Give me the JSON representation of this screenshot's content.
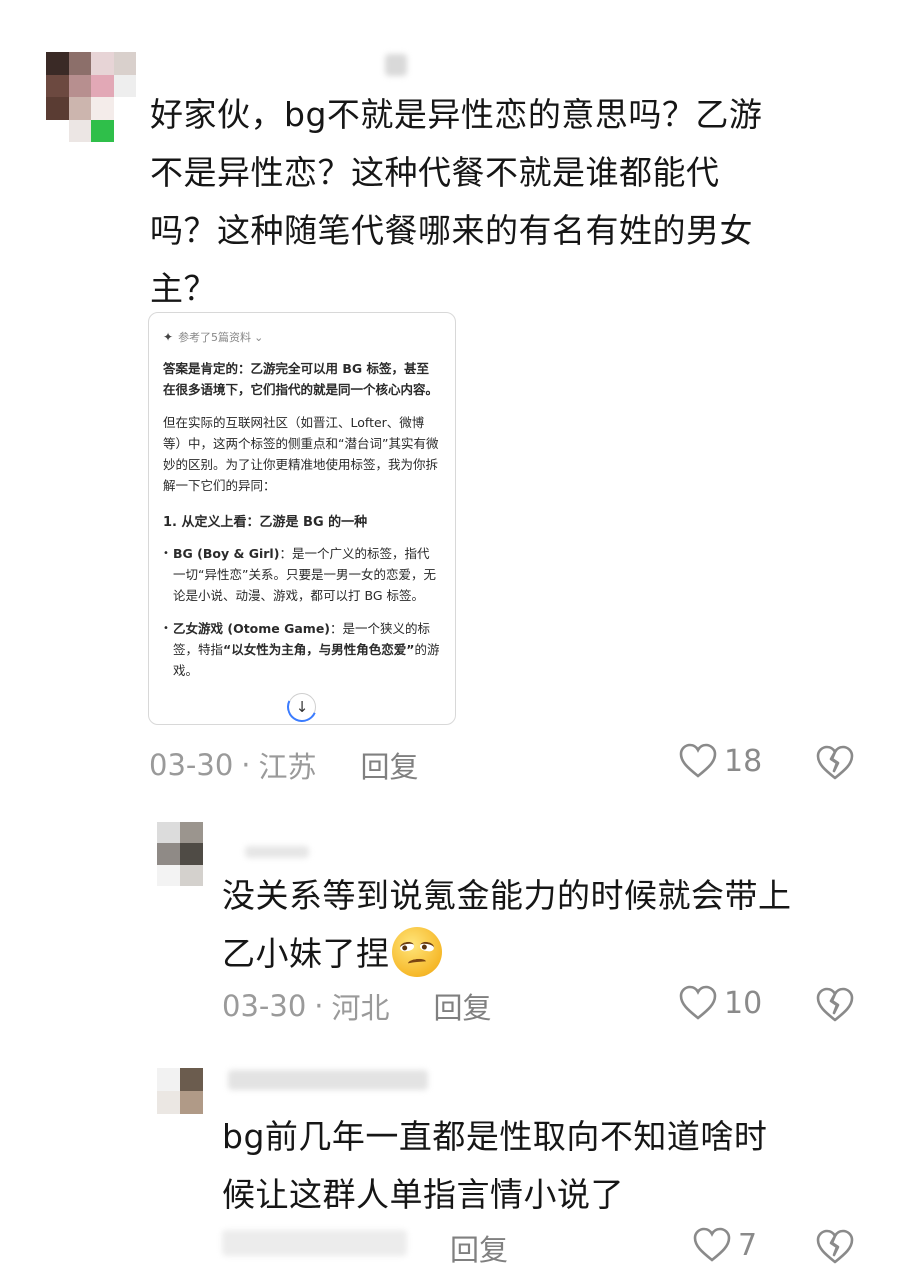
{
  "comments": [
    {
      "text_lines": [
        "好家伙，bg不就是异性恋的意思吗？乙游",
        "不是异性恋？这种代餐不就是谁都能代",
        "吗？这种随笔代餐哪来的有名有姓的男女",
        "主？"
      ],
      "date": "03-30",
      "location": "江苏",
      "reply_label": "回复",
      "likes": "18",
      "attachment": {
        "ref_label": "参考了5篇资料",
        "intro": "答案是肯定的：乙游完全可以用 BG 标签，甚至在很多语境下，它们指代的就是同一个核心内容。",
        "para": "但在实际的互联网社区（如晋江、Lofter、微博等）中，这两个标签的侧重点和“潜台词”其实有微妙的区别。为了让你更精准地使用标签，我为你拆解一下它们的异同：",
        "heading": "1. 从定义上看：乙游是 BG 的一种",
        "bullet1_bold": "BG (Boy & Girl)",
        "bullet1_text": "：是一个广义的标签，指代一切“异性恋”关系。只要是一男一女的恋爱，无论是小说、动漫、游戏，都可以打 BG 标签。",
        "bullet2_bold": "乙女游戏 (Otome Game)",
        "bullet2_text": "：是一个狭义的标签，特指",
        "bullet2_bold2": "“以女性为主角，与男性角色恋爱”",
        "bullet2_tail": "的游戏。"
      }
    },
    {
      "text_lines": [
        "没关系等到说氪金能力的时候就会带上",
        "乙小妹了捏"
      ],
      "emoji": "smirk-face-emoji",
      "date": "03-30",
      "location": "河北",
      "reply_label": "回复",
      "likes": "10"
    },
    {
      "text_lines": [
        "bg前几年一直都是性取向不知道啥时",
        "候让这群人单指言情小说了"
      ],
      "reply_label": "回复",
      "likes": "7"
    }
  ],
  "ui": {
    "separator": "·",
    "scroll_icon": "↓",
    "spark_icon": "✦",
    "chevron": "⌄"
  },
  "colors": {
    "text": "#161616",
    "meta": "#9a9a9a",
    "accent": "#3b7cff"
  }
}
